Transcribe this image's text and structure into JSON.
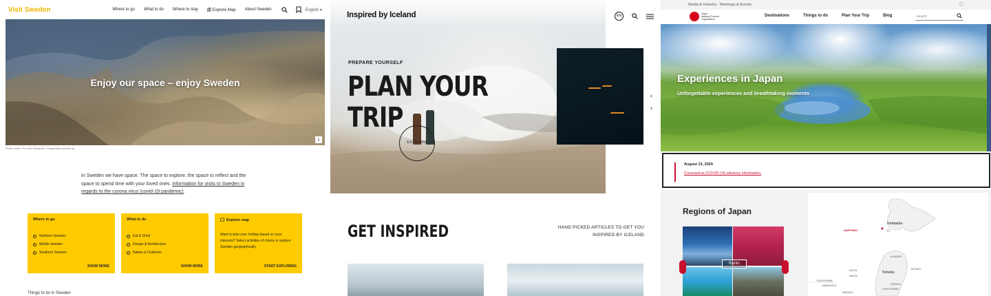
{
  "sweden": {
    "logo": "Visit Sweden",
    "nav": [
      "Where to go",
      "What to do",
      "Where to stay",
      "Explore Map",
      "About Sweden"
    ],
    "language": "English",
    "hero_title": "Enjoy our space – enjoy Sweden",
    "photo_credit": "Photo credit: Per-Olof Fahlström / imagebank.sweden.se",
    "intro_text": "In Sweden we have space. The space to explore, the space to reflect and the space to spend time with your loved ones.",
    "intro_link": "Information for visits to Sweden in regards to the corona virus (covid-19 pandemic)",
    "intro_end": ".",
    "cards": [
      {
        "title": "Where to go",
        "items": [
          "Northern Sweden",
          "Middle Sweden",
          "Southern Sweden"
        ],
        "more": "SHOW MORE"
      },
      {
        "title": "What to do",
        "items": [
          "Eat & Drink",
          "Design & Architecture",
          "Nature & Outdoors"
        ],
        "more": "SHOW MORE"
      },
      {
        "title": "Explore map",
        "text": "Want to plan your holiday based on your interests? Select activities of choice or explore Sweden geographically.",
        "more": "START EXPLORING"
      }
    ],
    "things_to_do": "Things to do in Sweden"
  },
  "iceland": {
    "logo": "Inspired by Iceland",
    "lang_badge": "EN",
    "pretitle": "PREPARE YOURSELF",
    "title_line1": "PLAN YOUR",
    "title_line2": "TRIP",
    "explore": "EXPLORE",
    "get_inspired": "GET INSPIRED",
    "hand_picked_line1": "HAND PICKED ARTICLES TO GET YOU",
    "hand_picked_line2": "INSPIRED BY ICELAND",
    "arrow_prev": "‹",
    "arrow_next": "›"
  },
  "japan": {
    "top_links": "Media & Industry · Meetings & Events",
    "logo_text_line1": "Japan",
    "logo_text_line2": "National Tourism Organization",
    "nav": [
      "Destinations",
      "Things to do",
      "Plan Your Trip",
      "Blog"
    ],
    "search_placeholder": "Search",
    "hero_title": "Experiences in Japan",
    "hero_subtitle": "Unforgettable experiences and breathtaking moments",
    "alert_date": "August 13, 2020",
    "alert_link": "Coronavirus (COVID-19) advisory information.",
    "regions_title": "Regions of Japan",
    "region_label": "Kanto",
    "map_labels": [
      "Hokkaido",
      "SAPPORO",
      "Tohoku",
      "SENDAI",
      "FUKUSHIMA",
      "TOKUSHIMA",
      "NIIGATA",
      "AKITA",
      "AOMORI",
      "IWATE",
      "YAMAGATA",
      "MIYAGI"
    ]
  }
}
